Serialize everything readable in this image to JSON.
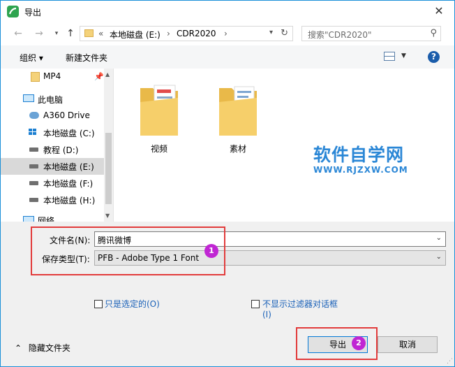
{
  "window": {
    "title": "导出",
    "close_glyph": "✕"
  },
  "nav": {
    "back_glyph": "←",
    "forward_glyph": "→",
    "up_glyph": "↑",
    "breadcrumb_sep": "«",
    "breadcrumbs": [
      "本地磁盘 (E:)",
      "CDR2020"
    ],
    "crumb_arrow": "›",
    "search_placeholder": "搜索\"CDR2020\""
  },
  "toolbar": {
    "organize": "组织 ▾",
    "new_folder": "新建文件夹",
    "help": "?"
  },
  "sidebar": {
    "items": [
      {
        "label": "MP4",
        "icon": "folder-icon",
        "pinned": true
      },
      {
        "label": "此电脑",
        "icon": "computer-icon"
      },
      {
        "label": "A360 Drive",
        "icon": "cloud-drive-icon"
      },
      {
        "label": "本地磁盘 (C:)",
        "icon": "windows-drive-icon"
      },
      {
        "label": "教程 (D:)",
        "icon": "drive-icon"
      },
      {
        "label": "本地磁盘 (E:)",
        "icon": "drive-icon",
        "selected": true
      },
      {
        "label": "本地磁盘 (F:)",
        "icon": "drive-icon"
      },
      {
        "label": "本地磁盘 (H:)",
        "icon": "drive-icon"
      },
      {
        "label": "网络",
        "icon": "network-icon"
      }
    ]
  },
  "content": {
    "items": [
      {
        "name": "视频",
        "type": "folder"
      },
      {
        "name": "素材",
        "type": "folder"
      }
    ],
    "watermark": {
      "title": "软件自学网",
      "subtitle": "WWW.RJZXW.COM"
    }
  },
  "form": {
    "filename_label": "文件名(N):",
    "filename_value": "腾讯微博",
    "filetype_label": "保存类型(T):",
    "filetype_value": "PFB - Adobe Type 1 Font",
    "only_selected": "只是选定的(O)",
    "no_filter_dialog_line1": "不显示过滤器对话框",
    "no_filter_dialog_line2": "(I)",
    "badge_1": "1",
    "badge_2": "2"
  },
  "footer": {
    "hide_folders": "隐藏文件夹",
    "export_button": "导出",
    "cancel_button": "取消"
  },
  "colors": {
    "accent": "#0078d7",
    "highlight": "#e23b3b",
    "badge": "#c026d3",
    "watermark": "#2b87d6"
  }
}
